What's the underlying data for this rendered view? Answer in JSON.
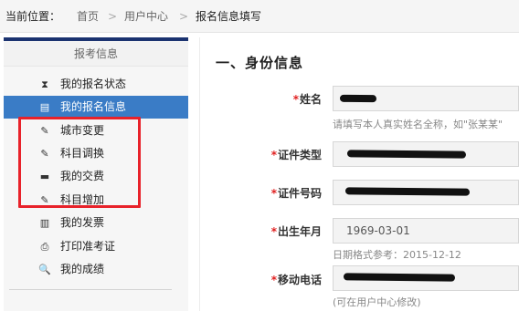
{
  "breadcrumb": {
    "label": "当前位置：",
    "items": [
      "首页",
      "用户中心",
      "报名信息填写"
    ],
    "separator": ">"
  },
  "sidebar": {
    "header": "报考信息",
    "items": [
      {
        "label": "我的报名状态",
        "icon": "hourglass-icon",
        "glyph": "⧗"
      },
      {
        "label": "我的报名信息",
        "icon": "list-icon",
        "glyph": "▤",
        "active": true
      },
      {
        "label": "城市变更",
        "icon": "edit-icon",
        "glyph": "✎"
      },
      {
        "label": "科目调换",
        "icon": "edit-icon",
        "glyph": "✎"
      },
      {
        "label": "我的交费",
        "icon": "card-icon",
        "glyph": "▬"
      },
      {
        "label": "科目增加",
        "icon": "edit-icon",
        "glyph": "✎"
      },
      {
        "label": "我的发票",
        "icon": "barcode-icon",
        "glyph": "▥"
      },
      {
        "label": "打印准考证",
        "icon": "printer-icon",
        "glyph": "⎙"
      },
      {
        "label": "我的成绩",
        "icon": "search-icon",
        "glyph": "🔍"
      }
    ]
  },
  "form": {
    "section_title": "一、身份信息",
    "required_mark": "*",
    "fields": {
      "name": {
        "label": "姓名",
        "hint": "请填写本人真实姓名全称，如\"张某某\""
      },
      "id_type": {
        "label": "证件类型"
      },
      "id_number": {
        "label": "证件号码"
      },
      "birth_date": {
        "label": "出生年月",
        "value": "1969-03-01",
        "hint": "日期格式参考：2015-12-12"
      },
      "mobile": {
        "label": "移动电话",
        "hint": "(可在用户中心修改)"
      }
    }
  },
  "colors": {
    "accent": "#3a7cc6",
    "sidebar_top": "#1b3370",
    "highlight_box": "#e8222a",
    "required": "#e02020"
  }
}
